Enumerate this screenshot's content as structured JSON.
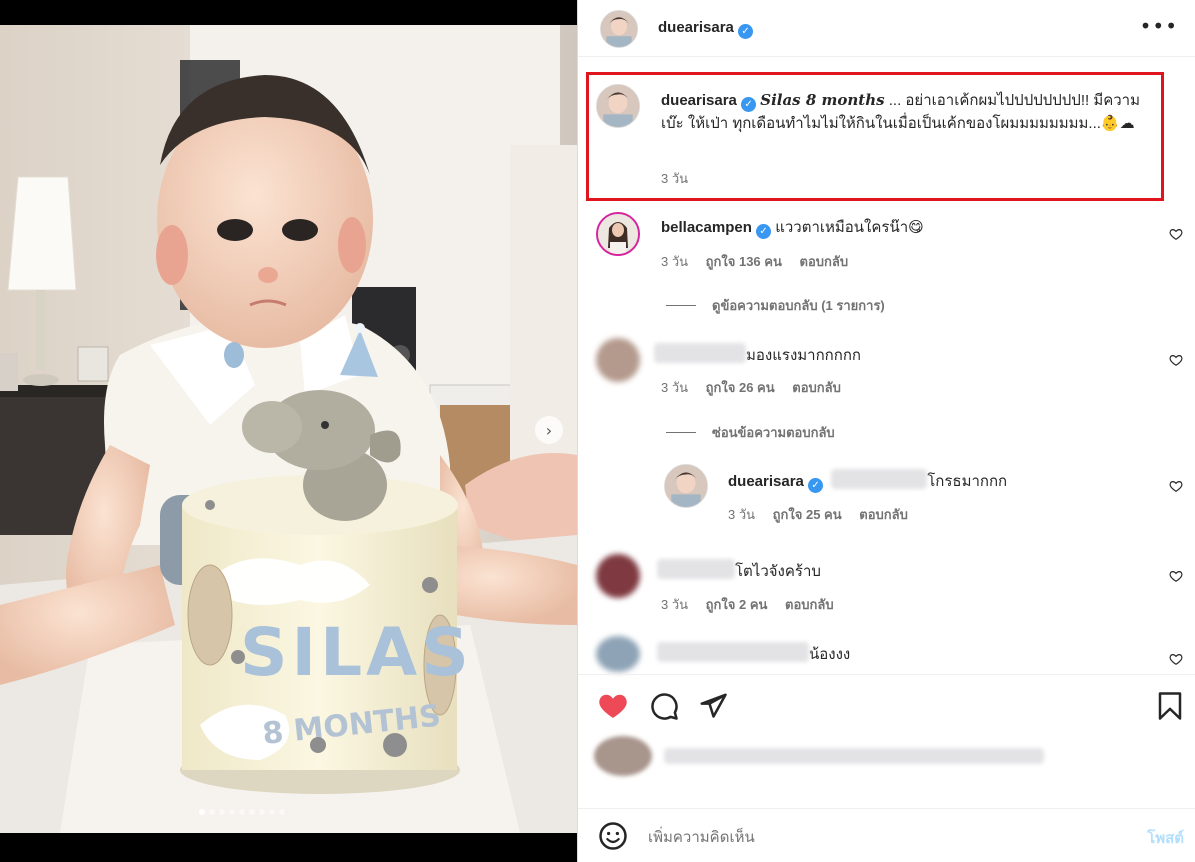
{
  "colors": {
    "accent": "#0095f6",
    "verified": "#3897f0",
    "like_red": "#ed4956",
    "highlight_border": "#e0141d"
  },
  "carousel": {
    "slide_count": 9,
    "active_index": 0,
    "next_icon": "chevron-right-icon",
    "next_glyph": "›"
  },
  "header": {
    "username": "duearisara",
    "verified_glyph": "✓",
    "more_glyph": "•••"
  },
  "caption": {
    "username": "duearisara",
    "title": "Silas 8 months",
    "text": " ... อย่าเอาเค้กผมไปปปปปปปป!! มีความเบ๊ะ ให้เป่า ทุกเดือนทำไมไม่ให้กินในเมื่อเป็นเค้กของโผมมมมมมมม...👶☁",
    "time": "3 วัน"
  },
  "comments": [
    {
      "username": "bellacampen",
      "verified": true,
      "text": "แววตาเหมือนใครน๊า😋",
      "time": "3 วัน",
      "likes": "ถูกใจ 136 คน",
      "reply": "ตอบกลับ",
      "thread": "ดูข้อความตอบกลับ (1 รายการ)"
    },
    {
      "username": "",
      "text": "มองแรงมากกกกก",
      "time": "3 วัน",
      "likes": "ถูกใจ 26 คน",
      "reply": "ตอบกลับ",
      "thread": "ซ่อนข้อความตอบกลับ"
    },
    {
      "username": "duearisara",
      "verified": true,
      "text": "โกรธมากกก",
      "time": "3 วัน",
      "likes": "ถูกใจ 25 คน",
      "reply": "ตอบกลับ"
    },
    {
      "username": "",
      "text": "โตไวจังคร้าบ",
      "time": "3 วัน",
      "likes": "ถูกใจ 2 คน",
      "reply": "ตอบกลับ"
    },
    {
      "username": "",
      "text": "น้องงง"
    }
  ],
  "actions": {
    "like_icon": "heart-filled-icon",
    "comment_icon": "comment-icon",
    "share_icon": "send-icon",
    "save_icon": "bookmark-icon"
  },
  "comment_box": {
    "placeholder": "เพิ่มความคิดเห็น",
    "post_label": "โพสต์",
    "emoji_icon": "emoji-icon"
  }
}
